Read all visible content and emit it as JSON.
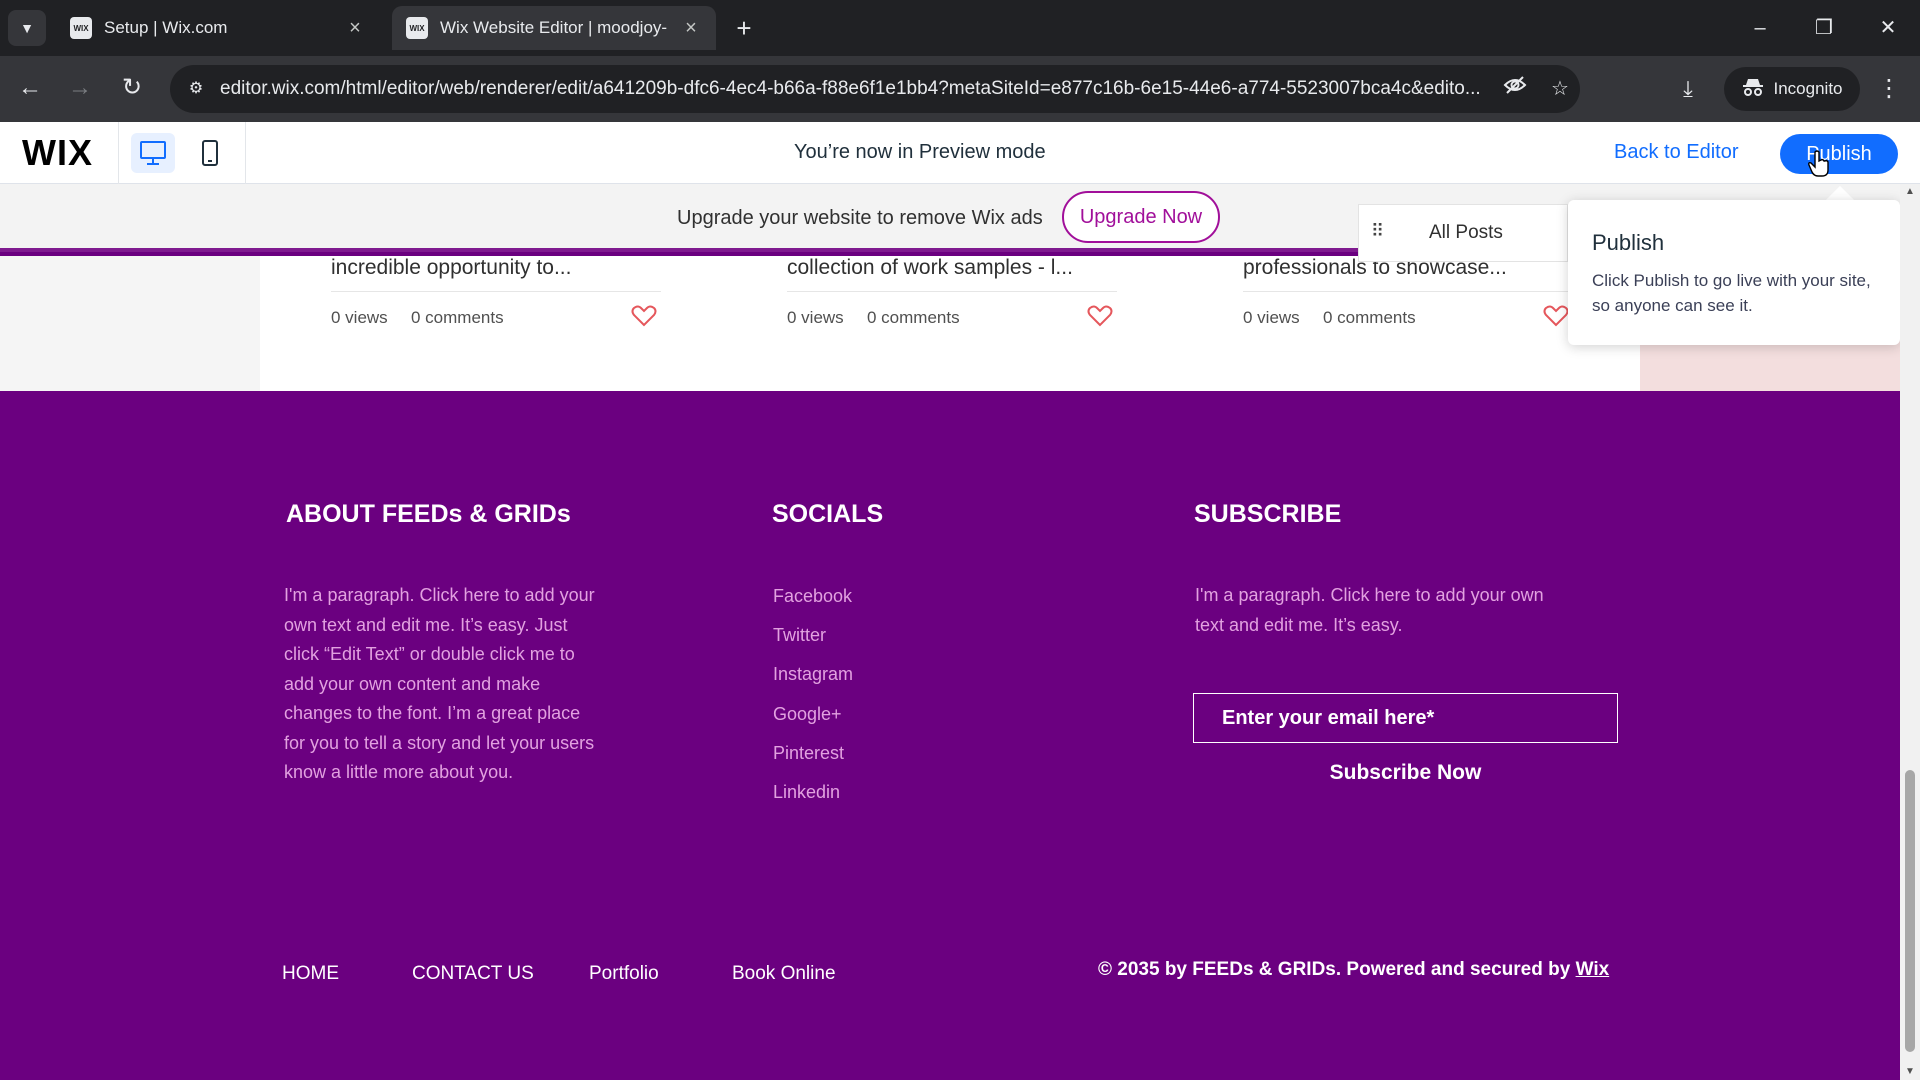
{
  "browser": {
    "tabs": [
      {
        "title": "Setup | Wix.com",
        "favicon": "WIX"
      },
      {
        "title": "Wix Website Editor | moodjoy-",
        "favicon": "WIX"
      }
    ],
    "url": "editor.wix.com/html/editor/web/renderer/edit/a641209b-dfc6-4ec4-b66a-f88e6f1e1bb4?metaSiteId=e877c16b-6e15-44e6-a774-5523007bca4c&edito...",
    "incognito_label": "Incognito"
  },
  "wixbar": {
    "logo": "WIX",
    "preview_message": "You’re now in Preview mode",
    "back_to_editor": "Back to Editor",
    "publish": "Publish"
  },
  "ad": {
    "text": "Upgrade your website to remove Wix ads",
    "button": "Upgrade Now"
  },
  "posts": [
    {
      "title": "incredible opportunity to...",
      "views": "0 views",
      "comments": "0 comments"
    },
    {
      "title": "collection of work samples - l...",
      "views": "0 views",
      "comments": "0 comments"
    },
    {
      "title": "professionals to showcase...",
      "views": "0 views",
      "comments": "0 comments"
    }
  ],
  "posts_control": {
    "label": "All Posts"
  },
  "tooltip": {
    "title": "Publish",
    "body": "Click Publish to go live with your site, so anyone can see it."
  },
  "footer": {
    "about": {
      "heading": "ABOUT FEEDs & GRIDs",
      "lines": [
        "I'm a paragraph. Click here to add your",
        "own text and edit me. It’s easy. Just",
        "click “Edit Text” or double click me to",
        "add your own content and make",
        "changes to the font. I’m a great place",
        "for you to tell a story and let your users",
        "know a little more about you."
      ]
    },
    "socials": {
      "heading": "SOCIALS",
      "links": [
        "Facebook",
        "Twitter",
        "Instagram",
        "Google+",
        "Pinterest",
        "Linkedin"
      ]
    },
    "subscribe": {
      "heading": "SUBSCRIBE",
      "lines": [
        "I'm a paragraph. Click here to add your own",
        "text and edit me. It’s easy."
      ],
      "email_placeholder": "Enter your email here*",
      "button": "Subscribe Now"
    },
    "nav": [
      "HOME",
      "CONTACT US",
      "Portfolio",
      "Book Online"
    ],
    "copyright_text": "© 2035 by FEEDs & GRIDs. Powered and secured by ",
    "copyright_link": "Wix"
  },
  "colors": {
    "footer_bg": "#6b0080",
    "footer_text": "#e2a1e0",
    "accent_blue": "#116dff",
    "upgrade_magenta": "#a10f9a"
  }
}
